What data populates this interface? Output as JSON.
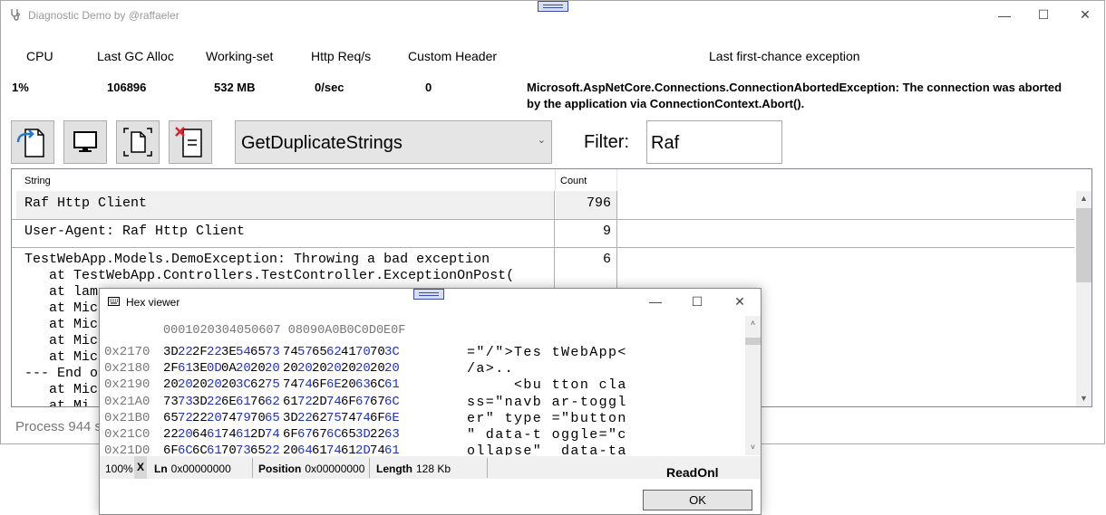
{
  "window": {
    "title": "Diagnostic Demo by @raffaeler"
  },
  "metrics": [
    {
      "label": "CPU",
      "value": "1%"
    },
    {
      "label": "Last GC Alloc",
      "value": "106896"
    },
    {
      "label": "Working-set",
      "value": "532 MB"
    },
    {
      "label": "Http Req/s",
      "value": "0/sec"
    },
    {
      "label": "Custom Header",
      "value": "0"
    }
  ],
  "exception": {
    "label": "Last first-chance exception",
    "value": "Microsoft.AspNetCore.Connections.ConnectionAbortedException: The connection was aborted by the application via ConnectionContext.Abort()."
  },
  "toolbar": {
    "combo_value": "GetDuplicateStrings",
    "filter_label": "Filter:",
    "filter_value": "Raf"
  },
  "grid": {
    "col_string": "String",
    "col_count": "Count",
    "rows": [
      {
        "string": "Raf Http Client",
        "count": "796"
      },
      {
        "string": "User-Agent: Raf Http Client",
        "count": "9"
      },
      {
        "string": "TestWebApp.Models.DemoException: Throwing a bad exception\n   at TestWebApp.Controllers.TestController.ExceptionOnPost(\n   at lam\n   at Mic\n   at Mic\n   at Mic\n   at Mic\n--- End o\n   at Mic\n   at Mi",
        "count": "6"
      }
    ]
  },
  "status": {
    "text": "Process 944 s"
  },
  "hex_viewer": {
    "title": "Hex viewer",
    "header": "0001020304050607 08090A0B0C0D0E0F",
    "rows": [
      {
        "offset": "0x2170",
        "bytes": [
          "3D",
          "22",
          "2F",
          "22",
          "3E",
          "54",
          "65",
          "73",
          "74",
          "57",
          "65",
          "62",
          "41",
          "70",
          "70",
          "3C"
        ],
        "ascii": "=\"/\">Tes tWebApp<"
      },
      {
        "offset": "0x2180",
        "bytes": [
          "2F",
          "61",
          "3E",
          "0D",
          "0A",
          "20",
          "20",
          "20",
          "20",
          "20",
          "20",
          "20",
          "20",
          "20",
          "20",
          "20"
        ],
        "ascii": "/a>..           "
      },
      {
        "offset": "0x2190",
        "bytes": [
          "20",
          "20",
          "20",
          "20",
          "20",
          "3C",
          "62",
          "75",
          "74",
          "74",
          "6F",
          "6E",
          "20",
          "63",
          "6C",
          "61"
        ],
        "ascii": "     <bu tton cla"
      },
      {
        "offset": "0x21A0",
        "bytes": [
          "73",
          "73",
          "3D",
          "22",
          "6E",
          "61",
          "76",
          "62",
          "61",
          "72",
          "2D",
          "74",
          "6F",
          "67",
          "67",
          "6C"
        ],
        "ascii": "ss=\"navb ar-toggl"
      },
      {
        "offset": "0x21B0",
        "bytes": [
          "65",
          "72",
          "22",
          "20",
          "74",
          "79",
          "70",
          "65",
          "3D",
          "22",
          "62",
          "75",
          "74",
          "74",
          "6F",
          "6E"
        ],
        "ascii": "er\" type =\"button"
      },
      {
        "offset": "0x21C0",
        "bytes": [
          "22",
          "20",
          "64",
          "61",
          "74",
          "61",
          "2D",
          "74",
          "6F",
          "67",
          "67",
          "6C",
          "65",
          "3D",
          "22",
          "63"
        ],
        "ascii": "\" data-t oggle=\"c"
      },
      {
        "offset": "0x21D0",
        "bytes": [
          "6F",
          "6C",
          "6C",
          "61",
          "70",
          "73",
          "65",
          "22",
          "20",
          "64",
          "61",
          "74",
          "61",
          "2D",
          "74",
          "61"
        ],
        "ascii": "ollapse\"  data-ta"
      }
    ],
    "status": {
      "zoom": "100%",
      "x_label": "X",
      "ln_label": "Ln",
      "ln_value": "0x00000000",
      "position_label": "Position",
      "position_value": "0x00000000",
      "length_label": "Length",
      "length_value": "128 Kb",
      "readonly": "ReadOnl"
    },
    "ok_label": "OK"
  }
}
